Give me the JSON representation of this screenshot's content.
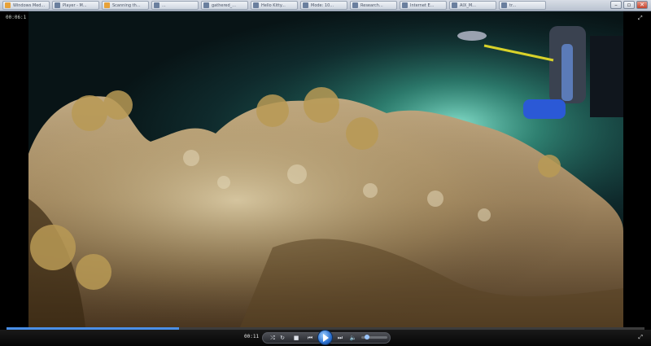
{
  "window": {
    "tabs": [
      {
        "label": "Windows Med...",
        "color": "#e7a23a"
      },
      {
        "label": "Player - M...",
        "color": "#6a7f9e"
      },
      {
        "label": "Scanning th...",
        "color": "#e7a23a"
      },
      {
        "label": "...",
        "color": "#6a7f9e"
      },
      {
        "label": "gathered_...",
        "color": "#6a7f9e"
      },
      {
        "label": "Hello Kitty...",
        "color": "#6a7f9e"
      },
      {
        "label": "Mode: 10...",
        "color": "#6a7f9e"
      },
      {
        "label": "Research...",
        "color": "#6a7f9e"
      },
      {
        "label": "Internet E...",
        "color": "#6a7f9e"
      },
      {
        "label": "AIX_M...",
        "color": "#6a7f9e"
      },
      {
        "label": "tr...",
        "color": "#6a7f9e"
      }
    ],
    "buttons": {
      "minimize": "–",
      "maximize": "▫",
      "close": "✕"
    }
  },
  "player": {
    "timecode_top": "00:06:1",
    "current_time": "00:11",
    "progress": 0.27,
    "volume": 0.15,
    "accent": "#4a8fe7",
    "icons": {
      "shuffle": "⤮",
      "repeat": "↻",
      "stop": "■",
      "prev": "⏮",
      "next": "⏭",
      "volume": "🔈",
      "fullscreen": "⤢"
    }
  }
}
